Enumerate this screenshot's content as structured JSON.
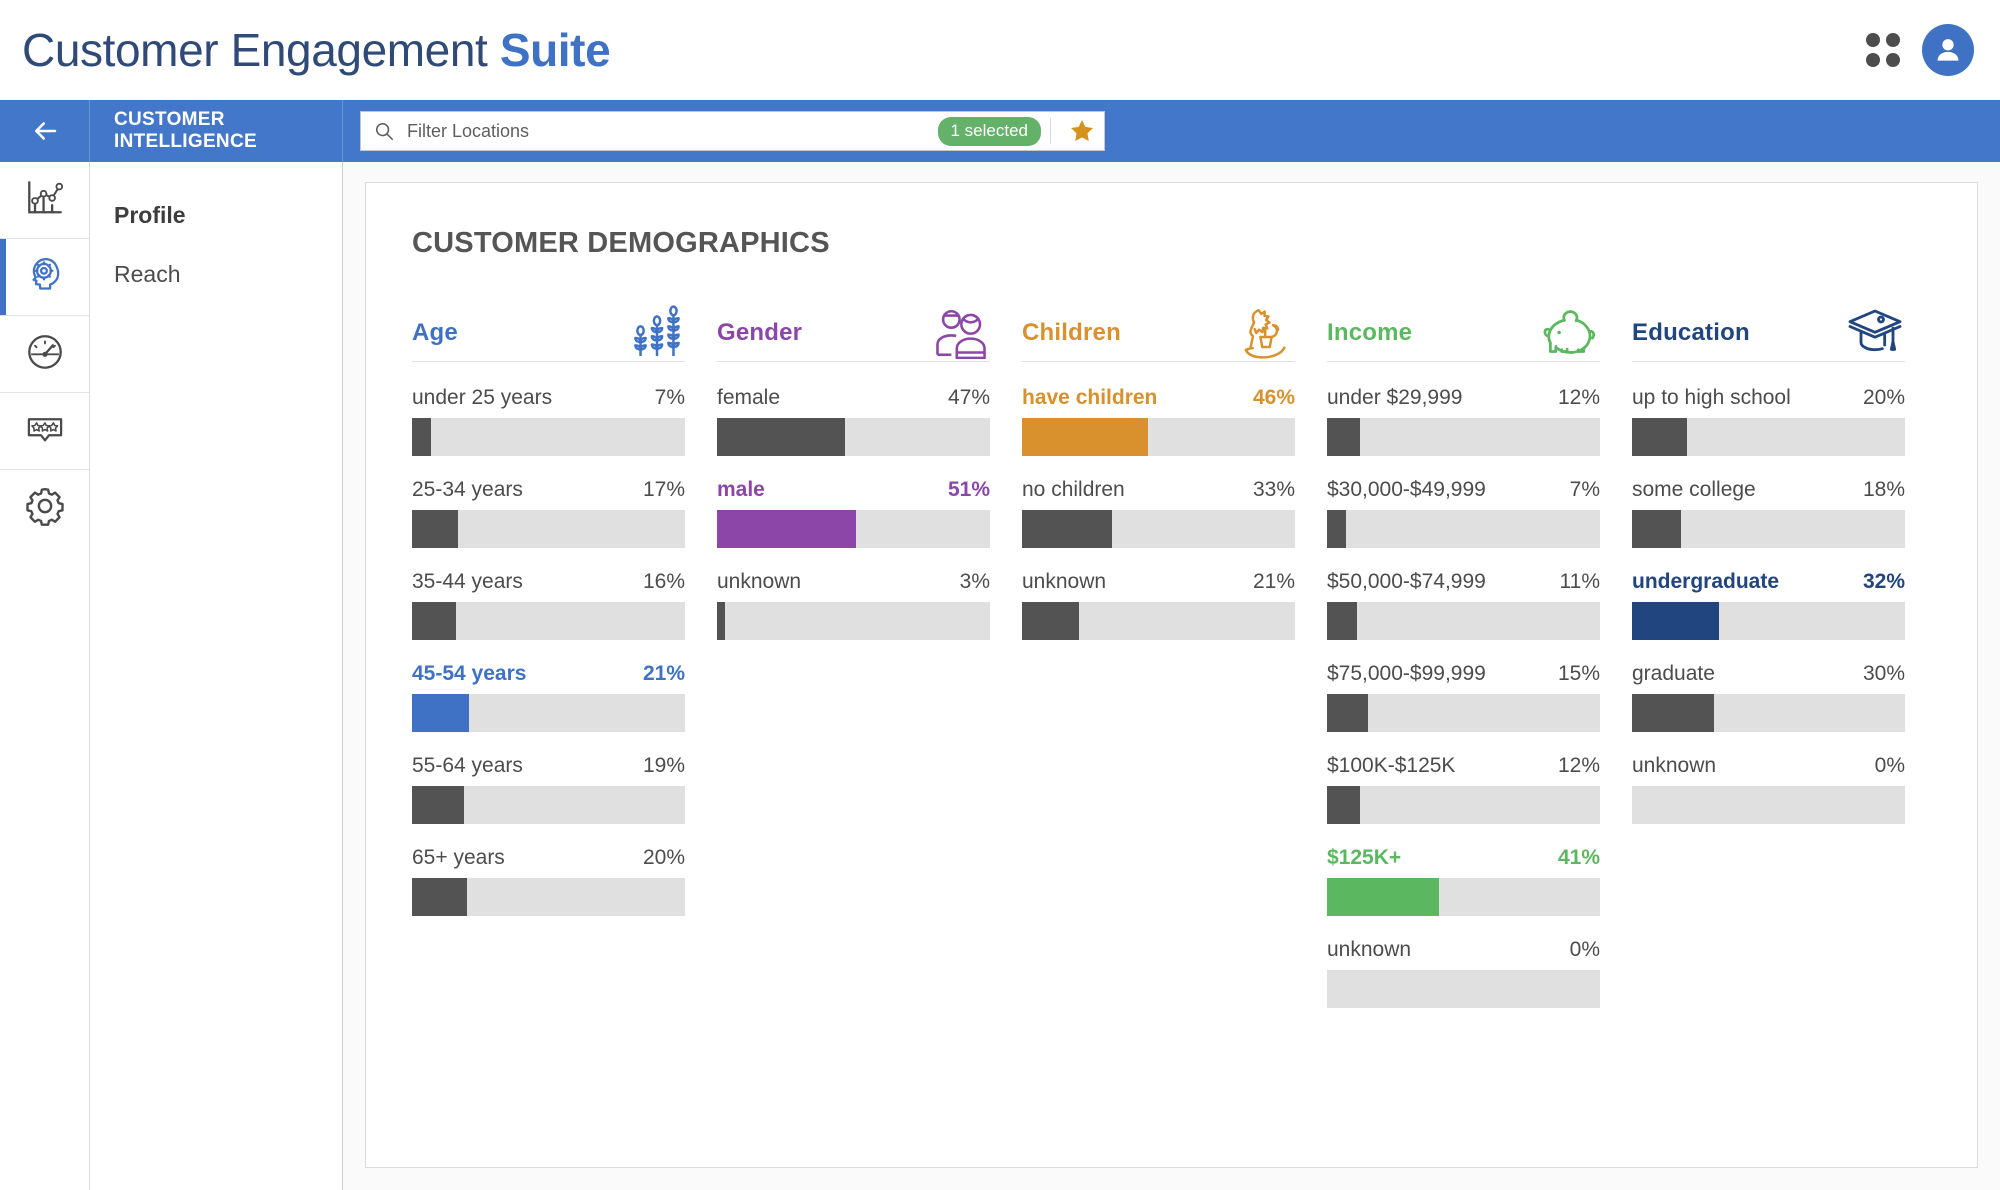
{
  "app": {
    "title_regular": "Customer Engagement ",
    "title_bold": "Suite",
    "apps_icon": "apps-grid-icon",
    "avatar_icon": "user-avatar-icon"
  },
  "nav": {
    "back_icon": "back-arrow-icon",
    "module_line1": "CUSTOMER",
    "module_line2": "INTELLIGENCE",
    "filter": {
      "search_icon": "search-icon",
      "placeholder": "Filter Locations",
      "value": "",
      "selected_badge": "1 selected",
      "star_icon": "star-icon"
    }
  },
  "rail": {
    "items": [
      {
        "icon": "analytics-chart-icon",
        "active": false
      },
      {
        "icon": "brain-gear-icon",
        "active": true
      },
      {
        "icon": "gauge-icon",
        "active": false
      },
      {
        "icon": "reviews-stars-icon",
        "active": false
      },
      {
        "icon": "settings-gear-icon",
        "active": false
      }
    ]
  },
  "sections": {
    "items": [
      {
        "label": "Profile",
        "active": true
      },
      {
        "label": "Reach",
        "active": false
      }
    ]
  },
  "colors": {
    "brand_blue": "#4277c9",
    "title_navy": "#2f4a77",
    "age": "#3f72c4",
    "gender": "#8b46a8",
    "children": "#d9912e",
    "income": "#5cb860",
    "education": "#21457e",
    "neutral_bar": "#535353",
    "track": "#e0e0e0",
    "badge_green": "#64b169",
    "star_gold": "#d6921f"
  },
  "chart_data": {
    "type": "bar",
    "title": "CUSTOMER DEMOGRAPHICS",
    "xlabel": "",
    "ylabel": "",
    "xlim": [
      0,
      100
    ],
    "grid": false,
    "legend": "none",
    "note": "Horizontal progress bars; bar length equals the percentage value. Highlighted (colored, bold) row per column is the dominant segment.",
    "columns": [
      {
        "name": "Age",
        "icon": "wheat-stalks-icon",
        "color": "#3f72c4",
        "categories": [
          "under 25 years",
          "25-34 years",
          "35-44 years",
          "45-54 years",
          "55-64 years",
          "65+ years"
        ],
        "values": [
          7,
          17,
          16,
          21,
          19,
          20
        ],
        "labels": [
          "7%",
          "17%",
          "16%",
          "21%",
          "19%",
          "20%"
        ],
        "highlight_index": 3
      },
      {
        "name": "Gender",
        "icon": "two-people-icon",
        "color": "#8b46a8",
        "categories": [
          "female",
          "male",
          "unknown"
        ],
        "values": [
          47,
          51,
          3
        ],
        "labels": [
          "47%",
          "51%",
          "3%"
        ],
        "highlight_index": 1
      },
      {
        "name": "Children",
        "icon": "rocking-horse-icon",
        "color": "#d9912e",
        "categories": [
          "have children",
          "no children",
          "unknown"
        ],
        "values": [
          46,
          33,
          21
        ],
        "labels": [
          "46%",
          "33%",
          "21%"
        ],
        "highlight_index": 0
      },
      {
        "name": "Income",
        "icon": "piggy-bank-icon",
        "color": "#5cb860",
        "categories": [
          "under $29,999",
          "$30,000-$49,999",
          "$50,000-$74,999",
          "$75,000-$99,999",
          "$100K-$125K",
          "$125K+",
          "unknown"
        ],
        "values": [
          12,
          7,
          11,
          15,
          12,
          41,
          0
        ],
        "labels": [
          "12%",
          "7%",
          "11%",
          "15%",
          "12%",
          "41%",
          "0%"
        ],
        "highlight_index": 5
      },
      {
        "name": "Education",
        "icon": "graduation-cap-icon",
        "color": "#21457e",
        "categories": [
          "up to high school",
          "some college",
          "undergraduate",
          "graduate",
          "unknown"
        ],
        "values": [
          20,
          18,
          32,
          30,
          0
        ],
        "labels": [
          "20%",
          "18%",
          "32%",
          "30%",
          "0%"
        ],
        "highlight_index": 2
      }
    ]
  }
}
